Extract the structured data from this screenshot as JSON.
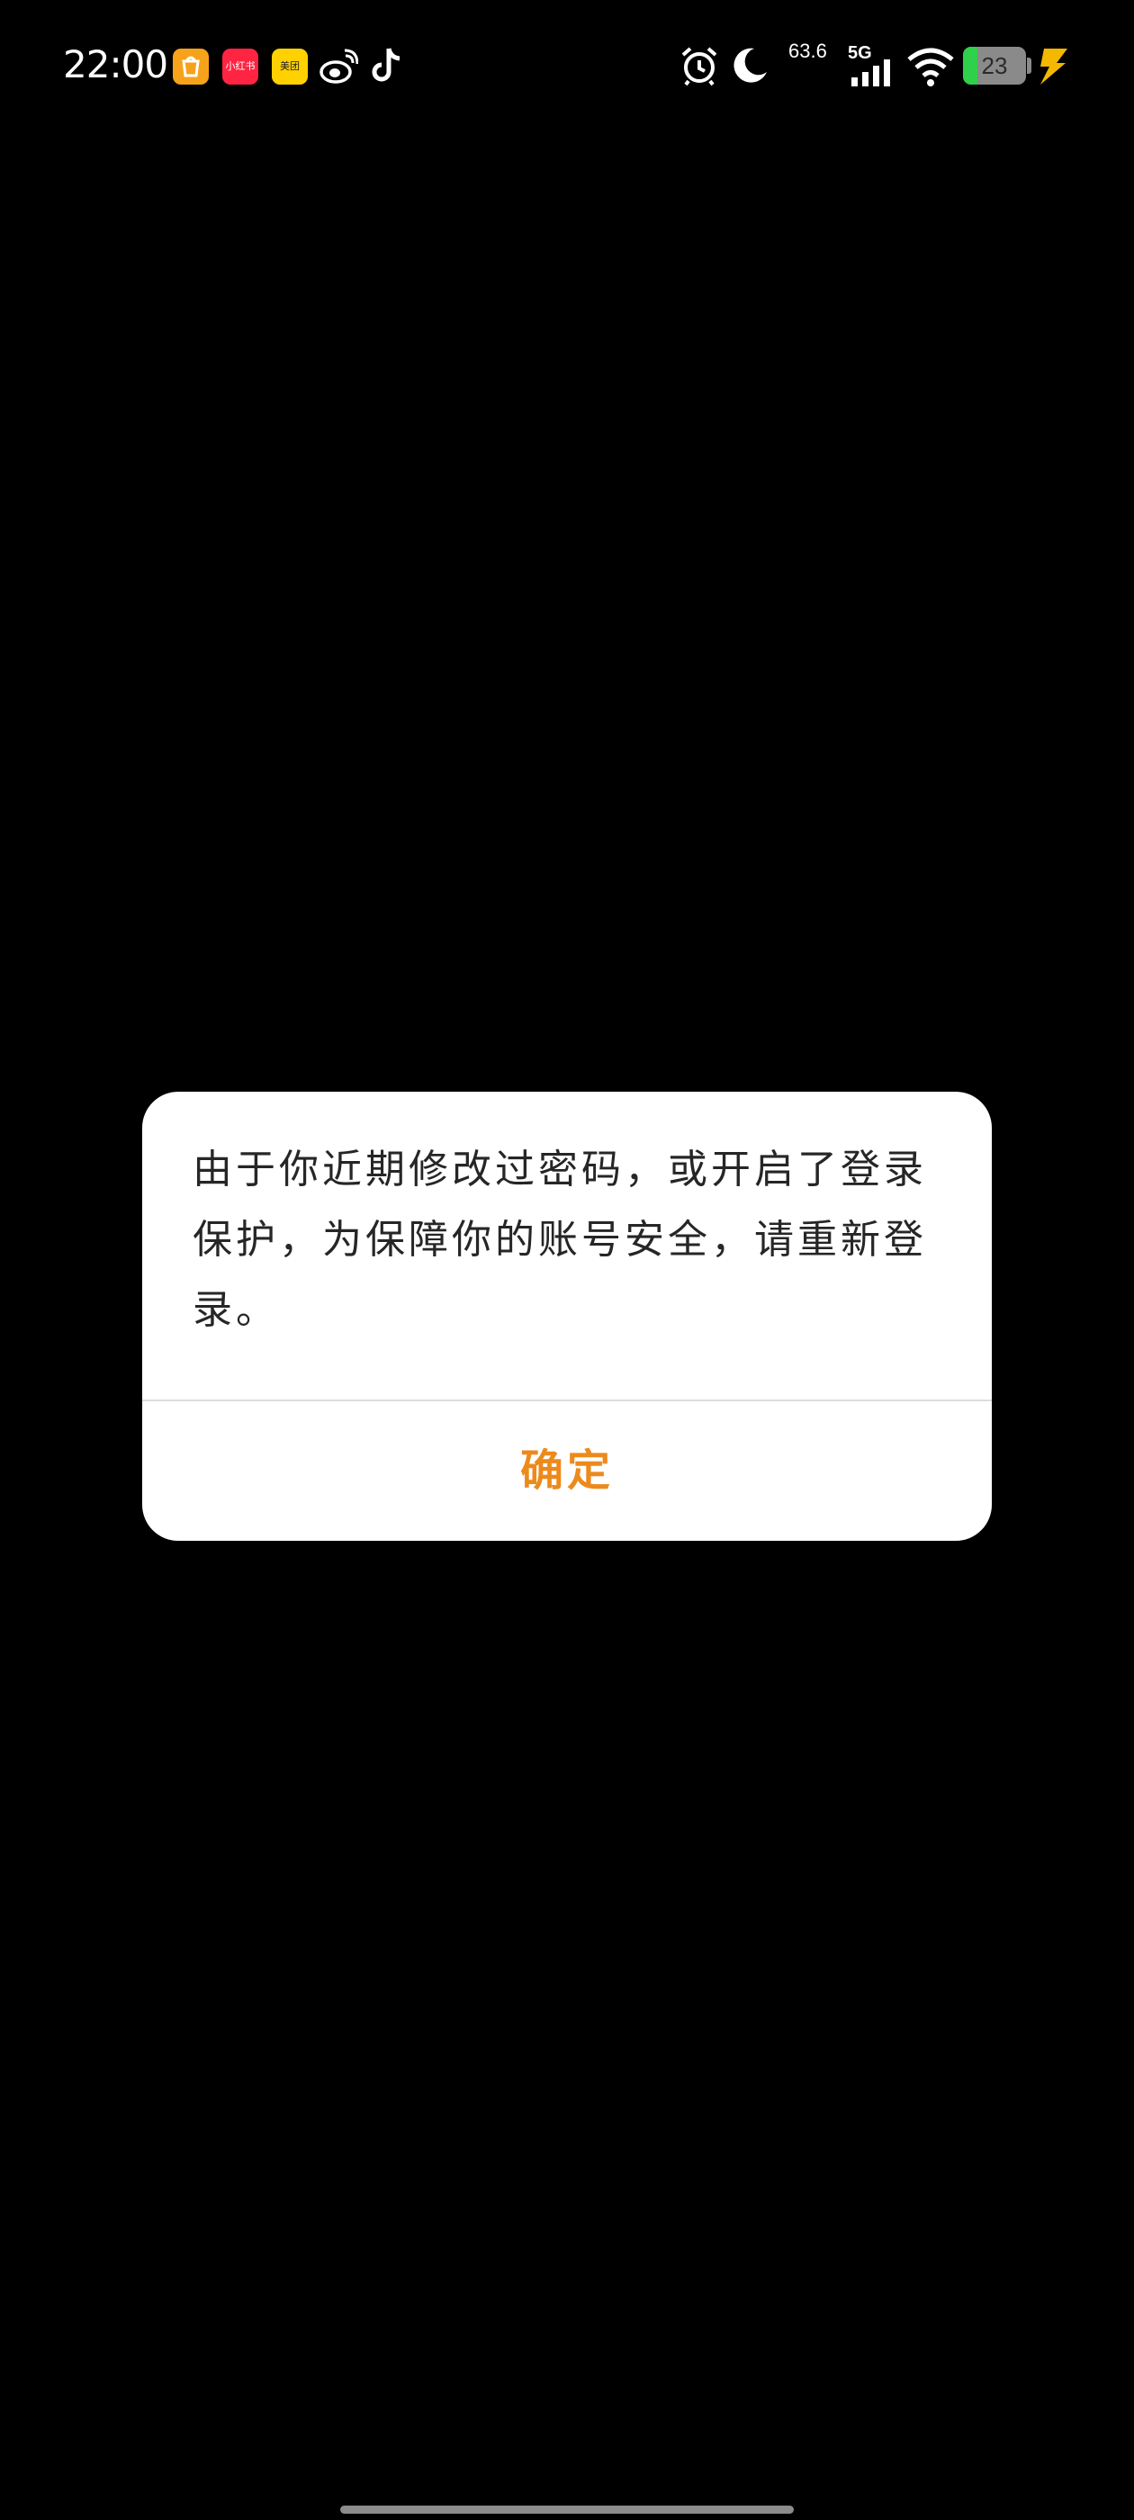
{
  "status_bar": {
    "time": "22:00",
    "apps": [
      {
        "icon": "taobao-shopping-icon",
        "color": "#f7a21b"
      },
      {
        "icon": "xiaohongshu-icon",
        "label": "小红书",
        "color": "#ff2442"
      },
      {
        "icon": "meituan-icon",
        "label": "美团",
        "color": "#ffd100"
      },
      {
        "icon": "weibo-icon"
      },
      {
        "icon": "tiktok-icon"
      }
    ],
    "alarm_icon": "alarm-clock-icon",
    "dnd_icon": "moon-icon",
    "network_speed": "63.6",
    "network_type": "5G",
    "wifi_icon": "wifi-icon",
    "battery_level": "23",
    "battery_fill_fraction": 0.23,
    "charging_icon": "lightning-icon",
    "colors": {
      "battery_fill": "#2fd04a",
      "charging": "#f5b800"
    }
  },
  "dialog": {
    "message": "由于你近期修改过密码，或开启了登录保护，为保障你的账号安全，请重新登录。",
    "confirm_label": "确定",
    "colors": {
      "confirm_text": "#ec8a1c",
      "background": "#ffffff"
    }
  }
}
